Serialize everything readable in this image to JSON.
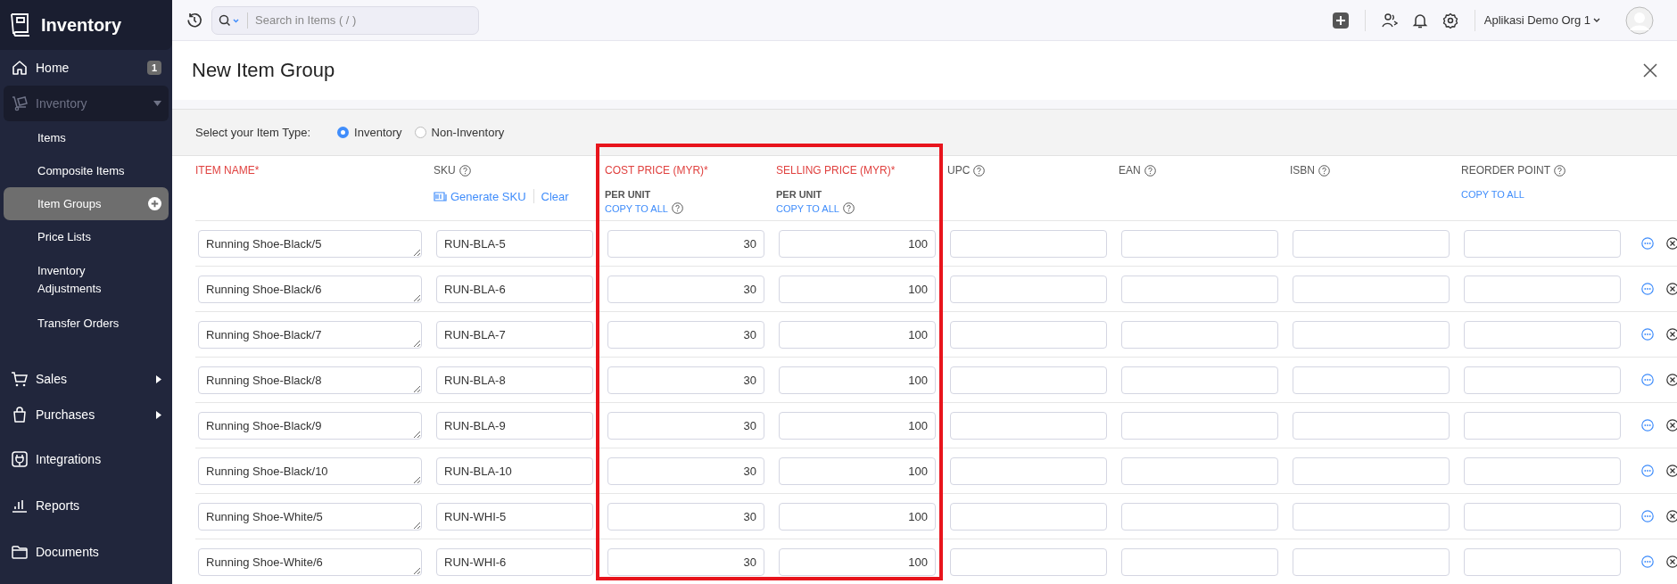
{
  "app": {
    "name": "Inventory"
  },
  "sidebar": [
    {
      "kind": "link",
      "label": "Home",
      "badge": "1"
    },
    {
      "kind": "menu",
      "label": "Inventory",
      "expanded": true,
      "children": [
        {
          "label": "Items",
          "selected": false
        },
        {
          "label": "Composite Items",
          "selected": false
        },
        {
          "label": "Item Groups",
          "selected": true
        },
        {
          "label": "Price Lists",
          "selected": false
        },
        {
          "label": "Inventory Adjustments",
          "selected": false
        },
        {
          "label": "Transfer Orders",
          "selected": false
        }
      ]
    },
    {
      "kind": "menu",
      "label": "Sales",
      "expanded": false
    },
    {
      "kind": "menu",
      "label": "Purchases",
      "expanded": false
    },
    {
      "kind": "link",
      "label": "Integrations"
    },
    {
      "kind": "link",
      "label": "Reports"
    },
    {
      "kind": "link",
      "label": "Documents"
    }
  ],
  "topbar": {
    "search": {
      "placeholder": "Search in Items ( / )"
    },
    "organization": "Aplikasi Demo Org 1"
  },
  "title": "New Item Group",
  "item_type": {
    "label": "Select your Item Type:",
    "options": [
      {
        "label": "Inventory",
        "selected": true
      },
      {
        "label": "Non-Inventory",
        "selected": false
      }
    ]
  },
  "columns": [
    {
      "label": "ITEM NAME*",
      "required": true,
      "help": false,
      "kind": "textarea"
    },
    {
      "label": "SKU",
      "required": false,
      "help": true,
      "kind": "text",
      "links": [
        {
          "label": "Generate SKU",
          "kind": "generate",
          "help": false
        },
        {
          "label": "Clear",
          "kind": "plain",
          "help": false
        }
      ]
    },
    {
      "label": "COST PRICE (MYR)*",
      "required": true,
      "help": false,
      "kind": "number",
      "subtitle": "PER UNIT",
      "links": [
        {
          "label": "COPY TO ALL",
          "kind": "plain",
          "help": true
        }
      ]
    },
    {
      "label": "SELLING PRICE (MYR)*",
      "required": true,
      "help": false,
      "kind": "number",
      "subtitle": "PER UNIT",
      "links": [
        {
          "label": "COPY TO ALL",
          "kind": "plain",
          "help": true
        }
      ]
    },
    {
      "label": "UPC",
      "required": false,
      "help": true,
      "kind": "text"
    },
    {
      "label": "EAN",
      "required": false,
      "help": true,
      "kind": "text"
    },
    {
      "label": "ISBN",
      "required": false,
      "help": true,
      "kind": "text"
    },
    {
      "label": "REORDER POINT",
      "required": false,
      "help": true,
      "kind": "number",
      "links": [
        {
          "label": "COPY TO ALL",
          "kind": "plain",
          "help": false
        }
      ]
    }
  ],
  "rows": [
    {
      "values": [
        "Running Shoe-Black/5",
        "RUN-BLA-5",
        "30",
        "100"
      ]
    },
    {
      "values": [
        "Running Shoe-Black/6",
        "RUN-BLA-6",
        "30",
        "100"
      ]
    },
    {
      "values": [
        "Running Shoe-Black/7",
        "RUN-BLA-7",
        "30",
        "100"
      ]
    },
    {
      "values": [
        "Running Shoe-Black/8",
        "RUN-BLA-8",
        "30",
        "100"
      ]
    },
    {
      "values": [
        "Running Shoe-Black/9",
        "RUN-BLA-9",
        "30",
        "100"
      ]
    },
    {
      "values": [
        "Running Shoe-Black/10",
        "RUN-BLA-10",
        "30",
        "100"
      ]
    },
    {
      "values": [
        "Running Shoe-White/5",
        "RUN-WHI-5",
        "30",
        "100"
      ]
    },
    {
      "values": [
        "Running Shoe-White/6",
        "RUN-WHI-6",
        "30",
        "100"
      ]
    }
  ]
}
